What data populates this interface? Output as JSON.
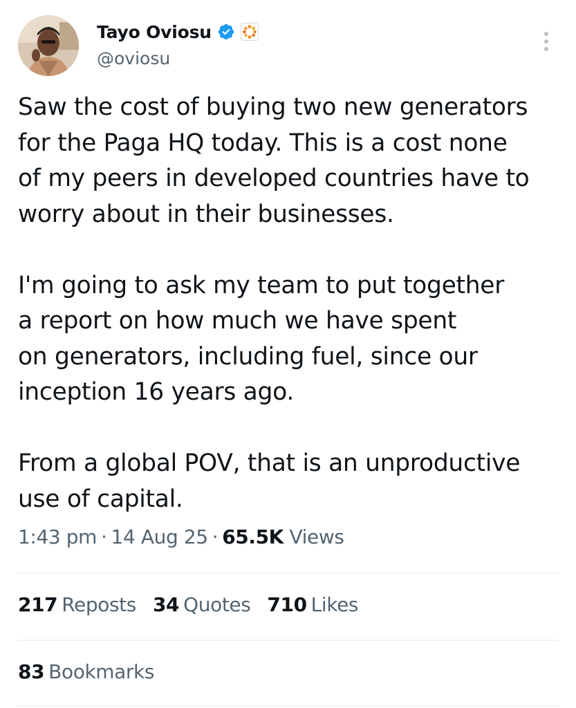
{
  "author": {
    "display_name": "Tayo Oviosu",
    "handle": "@oviosu",
    "avatar_icon": "user-avatar-photo",
    "verified_icon": "verified-badge-icon",
    "affiliate_icon": "affiliate-badge-icon"
  },
  "tweet": {
    "paragraphs": [
      [
        "Saw the cost of buying two new generators",
        "for the Paga HQ today. This is a cost none",
        "of my peers in developed countries have to",
        "worry about in their businesses."
      ],
      [
        "I'm going to ask my team to put together",
        "a report on how much we have spent",
        "on generators, including fuel, since our",
        "inception 16 years ago."
      ],
      [
        "From a global POV, that is an unproductive",
        "use of capital."
      ]
    ]
  },
  "meta": {
    "time": "1:43 pm",
    "date": "14 Aug 25",
    "views_count": "65.5K",
    "views_label": "Views",
    "separator": "·"
  },
  "stats": {
    "reposts": {
      "count": "217",
      "label": "Reposts"
    },
    "quotes": {
      "count": "34",
      "label": "Quotes"
    },
    "likes": {
      "count": "710",
      "label": "Likes"
    },
    "bookmarks": {
      "count": "83",
      "label": "Bookmarks"
    }
  },
  "colors": {
    "text_primary": "#0f1419",
    "text_secondary": "#536471",
    "verified_blue": "#1d9bf0",
    "affiliate_orange": "#f28b22",
    "divider": "#eff3f4"
  }
}
